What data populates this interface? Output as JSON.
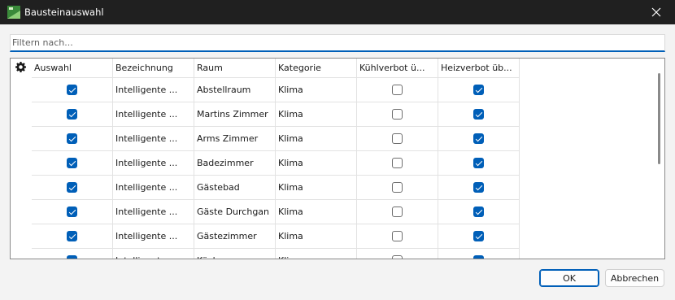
{
  "window": {
    "title": "Bausteinauswahl"
  },
  "filter": {
    "placeholder": "Filtern nach..."
  },
  "grid": {
    "columns": [
      "Auswahl",
      "Bezeichnung",
      "Raum",
      "Kategorie",
      "Kühlverbot ü...",
      "Heizverbot üb..."
    ],
    "rows": [
      {
        "auswahl": true,
        "bezeichnung": "Intelligente ...",
        "raum": "Abstellraum",
        "kategorie": "Klima",
        "kuehlverbot": false,
        "heizverbot": true
      },
      {
        "auswahl": true,
        "bezeichnung": "Intelligente ...",
        "raum": "Martins Zimmer",
        "kategorie": "Klima",
        "kuehlverbot": false,
        "heizverbot": true
      },
      {
        "auswahl": true,
        "bezeichnung": "Intelligente ...",
        "raum": "Arms Zimmer",
        "kategorie": "Klima",
        "kuehlverbot": false,
        "heizverbot": true
      },
      {
        "auswahl": true,
        "bezeichnung": "Intelligente ...",
        "raum": "Badezimmer",
        "kategorie": "Klima",
        "kuehlverbot": false,
        "heizverbot": true
      },
      {
        "auswahl": true,
        "bezeichnung": "Intelligente ...",
        "raum": "Gästebad",
        "kategorie": "Klima",
        "kuehlverbot": false,
        "heizverbot": true
      },
      {
        "auswahl": true,
        "bezeichnung": "Intelligente ...",
        "raum": "Gäste Durchgan",
        "kategorie": "Klima",
        "kuehlverbot": false,
        "heizverbot": true
      },
      {
        "auswahl": true,
        "bezeichnung": "Intelligente ...",
        "raum": "Gästezimmer",
        "kategorie": "Klima",
        "kuehlverbot": false,
        "heizverbot": true
      },
      {
        "auswahl": true,
        "bezeichnung": "Intelligente ...",
        "raum": "Küche",
        "kategorie": "Klima",
        "kuehlverbot": false,
        "heizverbot": true
      }
    ]
  },
  "buttons": {
    "ok": "OK",
    "cancel": "Abbrechen"
  },
  "colors": {
    "accent": "#005fb8",
    "titlebar": "#202020"
  }
}
